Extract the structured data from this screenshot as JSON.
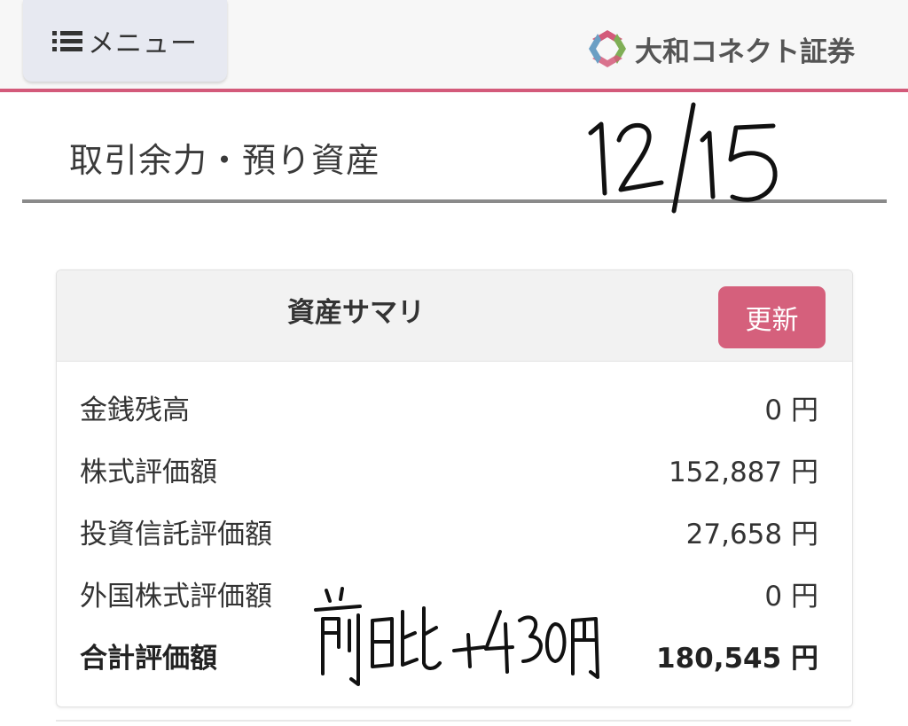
{
  "header": {
    "menu_label": "メニュー",
    "menu_icon": "list-icon",
    "brand_name": "大和コネクト証券",
    "brand_icon": "daiwa-connect-logo-icon",
    "accent_color": "#d35a7a"
  },
  "page": {
    "title": "取引余力・預り資産"
  },
  "summary": {
    "title": "資産サマリ",
    "refresh_label": "更新",
    "rows": [
      {
        "label": "金銭残高",
        "value": "0",
        "unit": "円"
      },
      {
        "label": "株式評価額",
        "value": "152,887",
        "unit": "円"
      },
      {
        "label": "投資信託評価額",
        "value": "27,658",
        "unit": "円"
      },
      {
        "label": "外国株式評価額",
        "value": "0",
        "unit": "円"
      },
      {
        "label": "合計評価額",
        "value": "180,545",
        "unit": "円"
      }
    ]
  },
  "annotations": {
    "handwritten_date": "12/15",
    "handwritten_note": "前日比 +430円"
  }
}
